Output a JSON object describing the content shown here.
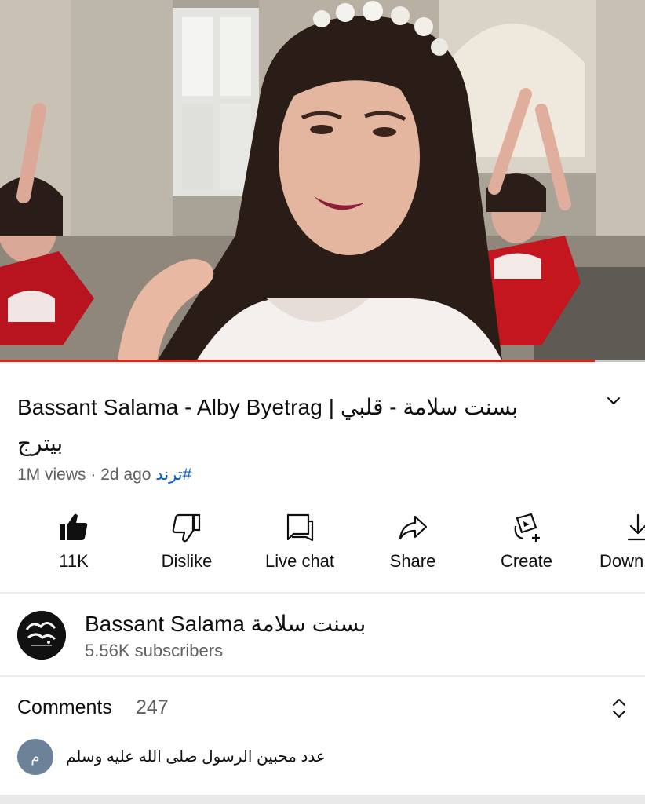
{
  "video": {
    "progress_fraction": 0.922,
    "progress_color": "#e62117"
  },
  "title": {
    "latin": "Bassant Salama - Alby Byetrag |",
    "arabic": "بسنت سلامة - قلبي بيترج"
  },
  "meta": {
    "views": "1M views",
    "separator": "·",
    "age": "2d ago",
    "hashtag": "#ترند"
  },
  "actions": [
    {
      "label": "11K",
      "icon": "thumbs-up-filled-icon"
    },
    {
      "label": "Dislike",
      "icon": "thumbs-down-icon"
    },
    {
      "label": "Live chat",
      "icon": "chat-bubble-icon"
    },
    {
      "label": "Share",
      "icon": "share-arrow-icon"
    },
    {
      "label": "Create",
      "icon": "create-remix-icon"
    },
    {
      "label": "Down",
      "icon": "download-icon"
    }
  ],
  "channel": {
    "name_latin": "Bassant Salama",
    "name_arabic": "بسنت سلامة",
    "subscribers": "5.56K subscribers"
  },
  "comments": {
    "title": "Comments",
    "count": "247",
    "first_comment_avatar_letter": "م",
    "first_comment_text": "عدد محبين الرسول صلى الله عليه وسلم"
  }
}
